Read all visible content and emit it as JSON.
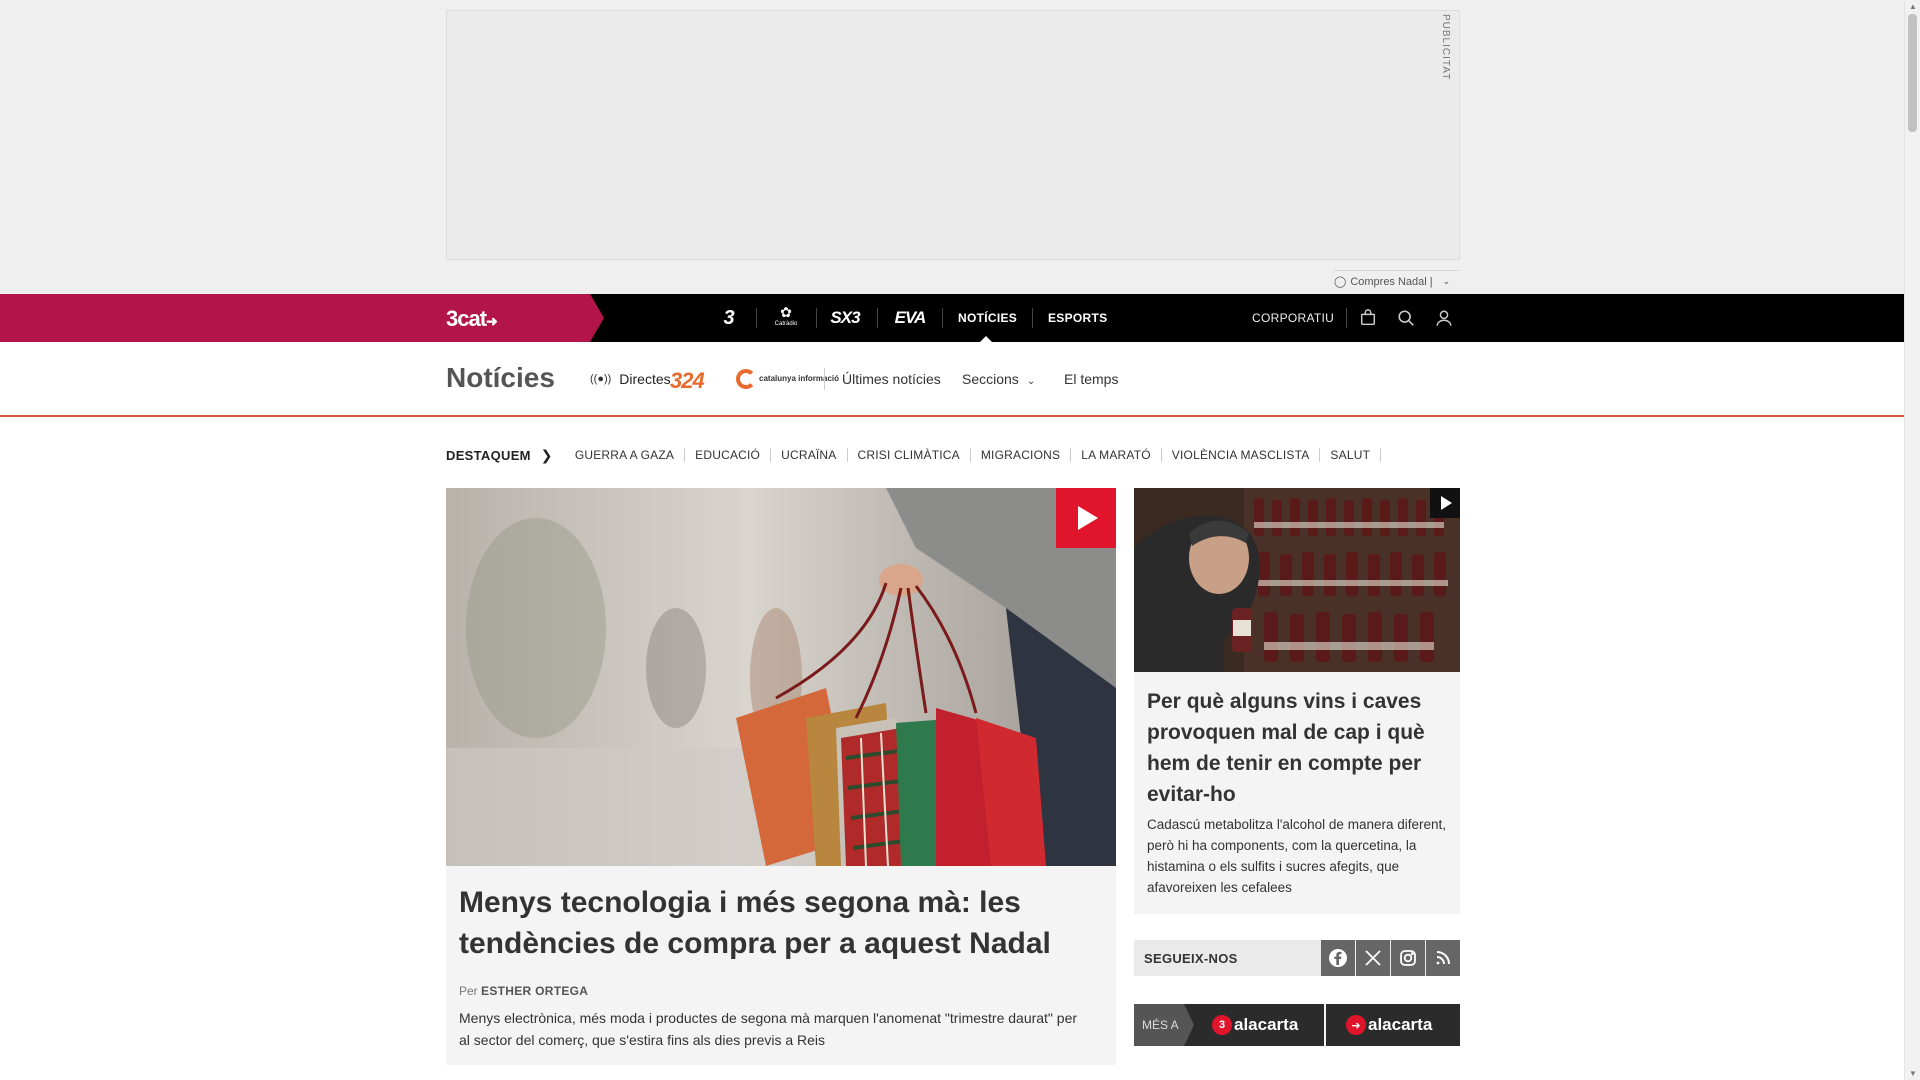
{
  "ad": {
    "label": "PUBLICITAT",
    "footer_text": "Compres Nadal |"
  },
  "topnav": {
    "brand": "3cat",
    "channels": [
      "3",
      "Cat",
      "SX3",
      "EVA"
    ],
    "channel_catradio_sub": "Catràdio",
    "noticies": "NOTÍCIES",
    "esports": "ESPORTS",
    "corporatiu": "CORPORATIU"
  },
  "section": {
    "title": "Notícies",
    "directes": "Directes",
    "logo_324": "324",
    "logo_catinfo": "catalunya informació",
    "ultimes": "Últimes notícies",
    "seccions": "Seccions",
    "temps": "El temps"
  },
  "highlights": {
    "title": "DESTAQUEM",
    "items": [
      "GUERRA A GAZA",
      "EDUCACIÓ",
      "UCRAÏNA",
      "CRISI CLIMÀTICA",
      "MIGRACIONS",
      "LA MARATÓ",
      "VIOLÈNCIA MASCLISTA",
      "SALUT"
    ]
  },
  "main_story": {
    "title": "Menys tecnologia i més segona mà: les tendències de compra per a aquest Nadal",
    "byline_prefix": "Per",
    "author": "ESTHER ORTEGA",
    "summary": "Menys electrònica, més moda i productes de segona mà marquen l'anomenat \"trimestre daurat\" per al sector del comerç, que s'estira fins als dies previs a Reis"
  },
  "side_story": {
    "title": "Per què alguns vins i caves provoquen mal de cap i què hem de tenir en compte per evitar-ho",
    "summary": "Cadascú metabolitza l'alcohol de manera diferent, però hi ha components, com la quercetina, la histamina o els sulfits i sucres afegits, que afavoreixen les cefalees"
  },
  "follow": {
    "label": "SEGUEIX-NOS",
    "networks": [
      "facebook-icon",
      "x-icon",
      "instagram-icon",
      "rss-icon"
    ]
  },
  "alacarta": {
    "mes_a": "MÉS A",
    "logo1": "alacarta",
    "logo2": "alacarta"
  },
  "colors": {
    "brand": "#b3144a",
    "accent_red": "#e0142a",
    "orange_rule": "#e05a3a"
  }
}
